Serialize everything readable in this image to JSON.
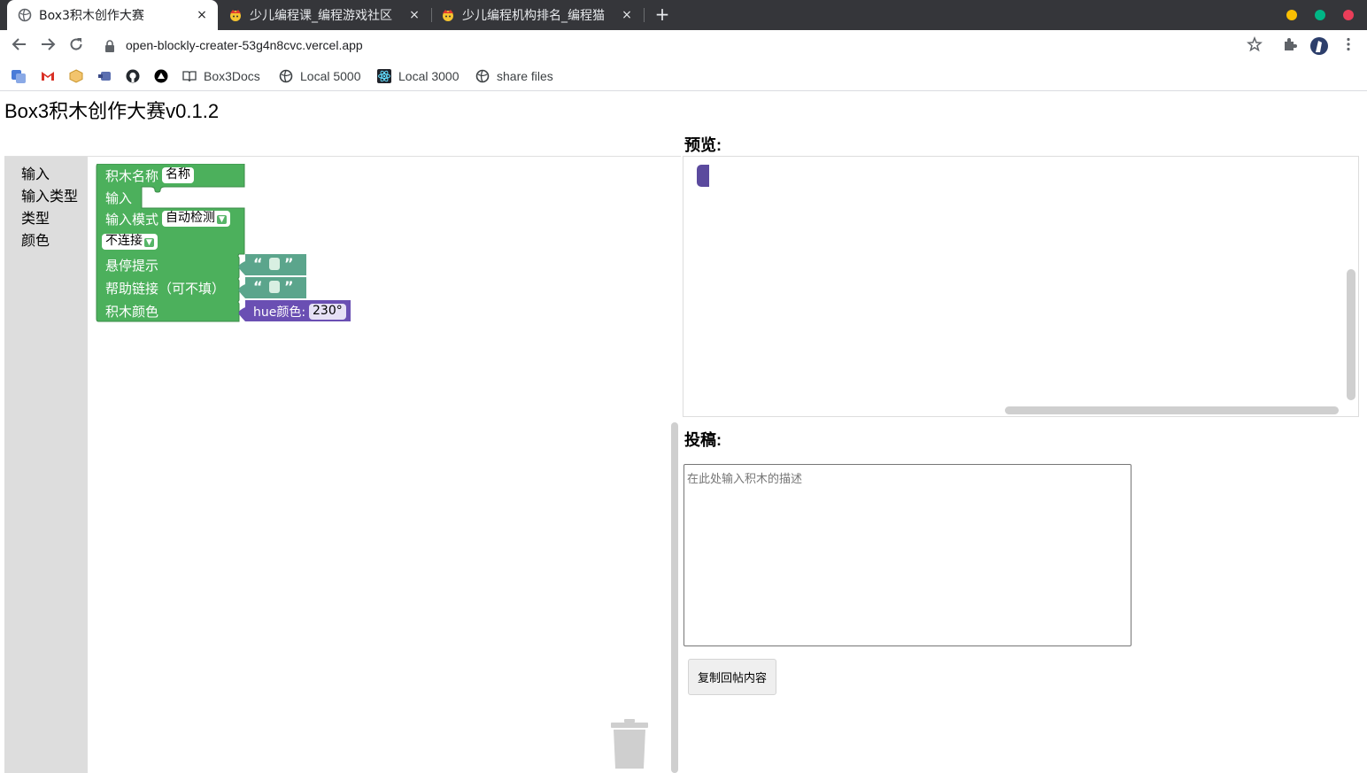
{
  "browser": {
    "tabs": [
      {
        "title": "Box3积木创作大赛",
        "active": true
      },
      {
        "title": "少儿编程课_编程游戏社区",
        "active": false
      },
      {
        "title": "少儿编程机构排名_编程猫",
        "active": false
      }
    ],
    "tab_close_glyph": "×",
    "new_tab_glyph": "+",
    "address": "open-blockly-creater-53g4n8cvc.vercel.app",
    "bookmarks": [
      "Box3Docs",
      "Local 5000",
      "Local 3000",
      "share files"
    ],
    "window_dot_colors": [
      "#f9bf03",
      "#00b686",
      "#ea3e59"
    ]
  },
  "page": {
    "title": "Box3积木创作大赛v0.1.2",
    "preview_label": "预览:",
    "submit_label": "投稿:",
    "description_placeholder": "在此处输入积木的描述",
    "copy_button": "复制回帖内容"
  },
  "toolbox": {
    "categories": [
      "输入",
      "输入类型",
      "类型",
      "颜色"
    ]
  },
  "block": {
    "color": "#4cb05c",
    "name_label": "积木名称",
    "name_value": "名称",
    "input_label": "输入",
    "input_mode_label": "输入模式",
    "input_mode_value": "自动检测",
    "connection_value": "不连接",
    "tooltip_label": "悬停提示",
    "help_label": "帮助链接（可不填）",
    "color_label": "积木颜色",
    "quote_open": "“",
    "quote_close": "”",
    "hue_label": "hue颜色:",
    "hue_value": "230°",
    "text_block_color": "#5ba58c",
    "hue_block_color": "#6a4fb3"
  }
}
